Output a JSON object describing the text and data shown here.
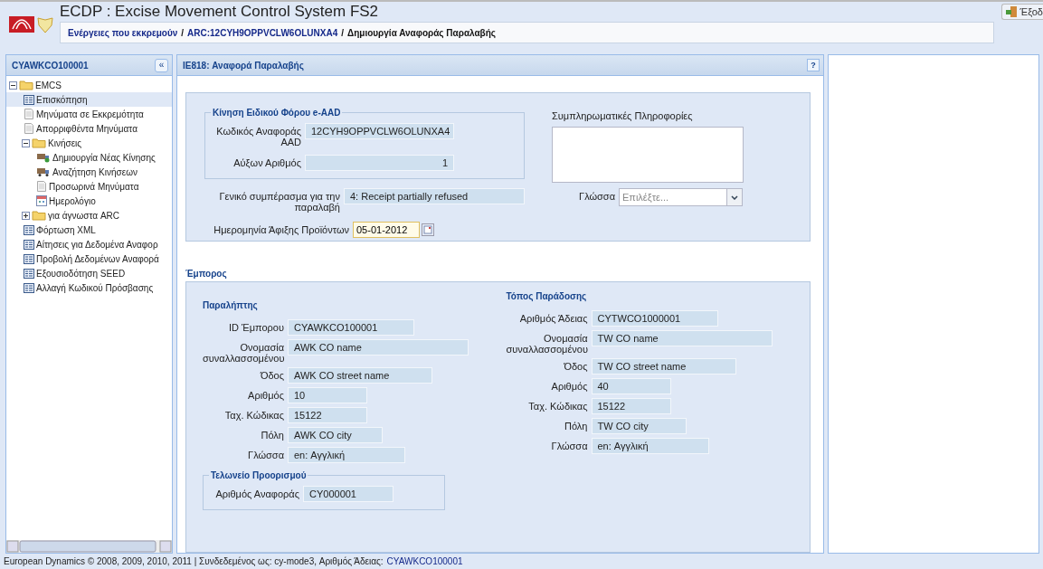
{
  "window": {
    "title": "ECDP : Excise Movement Control System FS2"
  },
  "breadcrumb": {
    "separator": "/",
    "items": [
      {
        "label": "Ενέργειες που εκκρεμούν",
        "link": true
      },
      {
        "label": "ARC:12CYH9OPPVCLW6OLUNXA4",
        "link": true
      },
      {
        "label": "Δημιουργία Αναφοράς Παραλαβής",
        "link": false
      }
    ]
  },
  "exit_button": {
    "label": "Έξοδ"
  },
  "sidebar": {
    "title": "CYAWKCO100001",
    "collapse": "«",
    "items": [
      {
        "label": "EMCS",
        "kind": "folder",
        "expanded": true,
        "selected": false,
        "children": [
          {
            "label": "Επισκόπηση",
            "kind": "list",
            "selected": true
          },
          {
            "label": "Μηνύματα σε Εκκρεμότητα",
            "kind": "doc",
            "selected": false
          },
          {
            "label": "Απορριφθέντα Μηνύματα",
            "kind": "doc",
            "selected": false
          },
          {
            "label": "Κινήσεις",
            "kind": "folder",
            "expanded": true,
            "selected": false,
            "children": [
              {
                "label": "Δημιουργία Νέας Κίνησης",
                "kind": "truck-add",
                "selected": false
              },
              {
                "label": "Αναζήτηση Κινήσεων",
                "kind": "truck-search",
                "selected": false
              },
              {
                "label": "Προσωρινά Μηνύματα",
                "kind": "doc",
                "selected": false
              },
              {
                "label": "Ημερολόγιο",
                "kind": "calendar",
                "selected": false
              }
            ]
          },
          {
            "label": "για άγνωστα ARC",
            "kind": "folder",
            "expanded": false,
            "selected": false
          },
          {
            "label": "Φόρτωση XML",
            "kind": "list",
            "selected": false
          },
          {
            "label": "Αίτησεις για Δεδομένα Αναφορ",
            "kind": "list",
            "selected": false
          },
          {
            "label": "Προβολή Δεδομένων Αναφορά",
            "kind": "list",
            "selected": false
          },
          {
            "label": "Εξουσιοδότηση SEED",
            "kind": "list",
            "selected": false
          },
          {
            "label": "Αλλαγή Κωδικού Πρόσβασης",
            "kind": "list",
            "selected": false
          }
        ]
      }
    ]
  },
  "main": {
    "title": "IE818: Αναφορά Παραλαβής",
    "help": "?",
    "eaad": {
      "legend": "Κίνηση Ειδικού Φόρου e-AAD",
      "fields": [
        {
          "label": "Κωδικός Αναφοράς AAD",
          "value": "12CYH9OPPVCLW6OLUNXA4"
        },
        {
          "label": "Αύξων Αριθμός",
          "value": "1",
          "right_aligned": true
        }
      ]
    },
    "complementary": {
      "label": "Συμπληρωματικές Πληροφορίες",
      "language_label": "Γλώσσα",
      "language_placeholder": "Επιλέξτε..."
    },
    "conclusion": {
      "label": "Γενικό συμπέρασμα για την παραλαβή",
      "value": "4: Receipt partially refused"
    },
    "arrival_date": {
      "label": "Ημερομηνία Άφιξης Προϊόντων",
      "value": "05-01-2012"
    },
    "trader": {
      "title": "Έμπορος",
      "consignee": {
        "title": "Παραλήπτης",
        "fields": [
          {
            "label": "ID Έμπορου",
            "value": "CYAWKCO100001"
          },
          {
            "label": "Ονομασία συναλλασσομένου",
            "value": "AWK CO name"
          },
          {
            "label": "Όδος",
            "value": "AWK CO street name"
          },
          {
            "label": "Αριθμός",
            "value": "10"
          },
          {
            "label": "Ταχ. Κώδικας",
            "value": "15122"
          },
          {
            "label": "Πόλη",
            "value": "AWK CO city"
          },
          {
            "label": "Γλώσσα",
            "value": "en: Αγγλική"
          }
        ]
      },
      "delivery": {
        "title": "Τόπος Παράδοσης",
        "fields": [
          {
            "label": "Αριθμός Άδειας",
            "value": "CYTWCO1000001"
          },
          {
            "label": "Ονομασία συναλλασσομένου",
            "value": "TW CO name"
          },
          {
            "label": "Όδος",
            "value": "TW CO street name"
          },
          {
            "label": "Αριθμός",
            "value": "40"
          },
          {
            "label": "Ταχ. Κώδικας",
            "value": "15122"
          },
          {
            "label": "Πόλη",
            "value": "TW CO city"
          },
          {
            "label": "Γλώσσα",
            "value": "en: Αγγλική"
          }
        ]
      },
      "destination_office": {
        "legend": "Τελωνείο Προορισμού",
        "fields": [
          {
            "label": "Αριθμός Αναφοράς",
            "value": "CY000001"
          }
        ]
      }
    }
  },
  "footer": {
    "text": "European Dynamics © 2008, 2009, 2010, 2011 | Συνδεδεμένος ως: cy-mode3, Αριθμός Άδειας:",
    "link": "CYAWKCO100001"
  }
}
